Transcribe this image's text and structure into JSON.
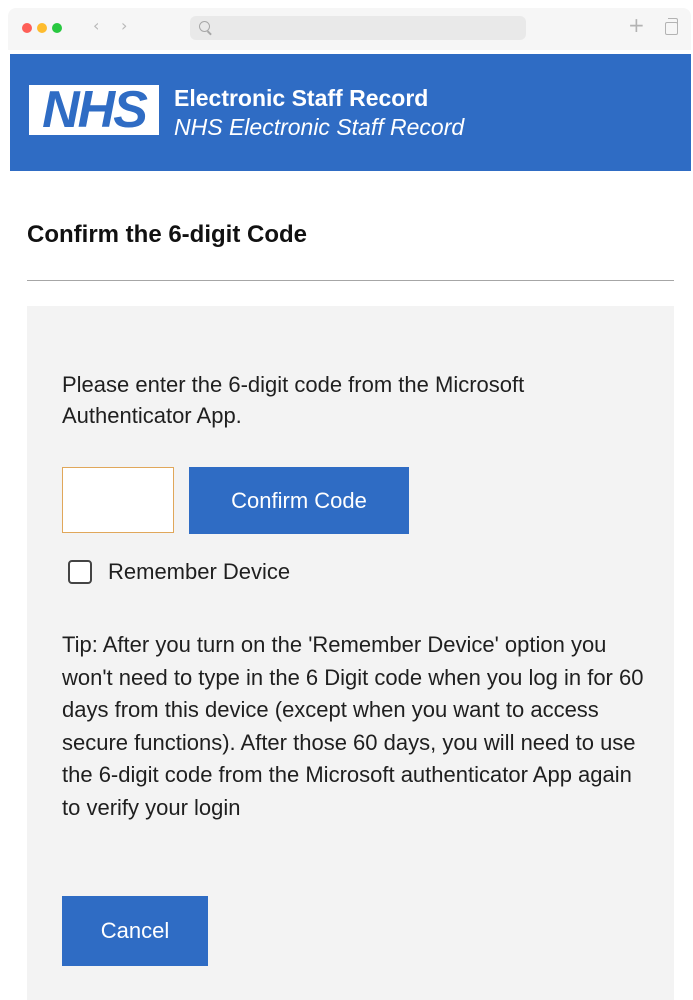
{
  "browser": {
    "address_value": "",
    "back_glyph": "‹",
    "forward_glyph": "›",
    "new_tab_glyph": "+"
  },
  "header": {
    "logo_text": "NHS",
    "title": "Electronic Staff Record",
    "subtitle": "NHS Electronic Staff Record",
    "brand_color": "#2f6cc4"
  },
  "main": {
    "page_title": "Confirm the 6-digit Code",
    "instruction": "Please enter the 6-digit code from the Microsoft Authenticator App.",
    "code_input_value": "",
    "confirm_button_label": "Confirm Code",
    "remember_device_label": "Remember Device",
    "remember_device_checked": false,
    "tip": "Tip: After you turn on the 'Remember Device' option you won't need to type in the 6 Digit code when you log in for 60 days from this device (except when you want to access secure functions). After those 60 days, you will need to use the 6-digit code from the Microsoft authenticator App again to verify your login",
    "cancel_button_label": "Cancel"
  }
}
